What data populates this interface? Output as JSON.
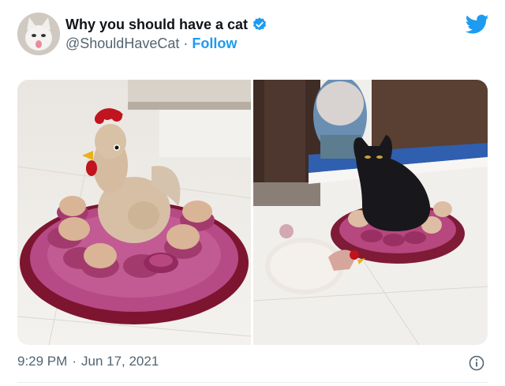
{
  "tweet": {
    "author": {
      "display_name": "Why you should have a cat",
      "handle": "@ShouldHaveCat",
      "verified": true,
      "follow_label": "Follow",
      "separator": "·"
    },
    "media": [
      {
        "subject": "crochet hen nest with eggs"
      },
      {
        "subject": "black cat sitting on crochet nest"
      }
    ],
    "time": "9:29 PM",
    "date": "Jun 17, 2021",
    "separator": "·"
  },
  "icons": {
    "verified": "verified-badge-icon",
    "logo": "twitter-bird-icon",
    "info": "info-icon"
  },
  "colors": {
    "brand": "#1d9bf0",
    "text": "#0f1419",
    "secondary_text": "#536471"
  }
}
